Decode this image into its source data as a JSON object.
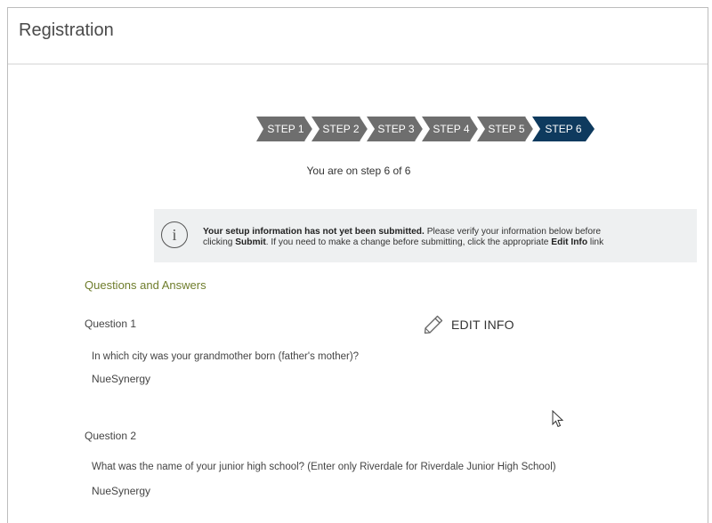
{
  "panel": {
    "title": "Registration"
  },
  "steps": {
    "items": [
      "STEP 1",
      "STEP 2",
      "STEP 3",
      "STEP 4",
      "STEP 5",
      "STEP 6"
    ],
    "active_index": 5,
    "caption": "You are on step 6 of 6",
    "colors": {
      "inactive": "#6e6e6e",
      "active": "#0e3a5e",
      "text": "#ffffff"
    }
  },
  "info": {
    "icon": "info-circle-icon",
    "line1_bold": "Your setup information has not yet been submitted.",
    "line1_rest": " Please verify your information below before",
    "line2_a": "clicking ",
    "line2_submit": "Submit",
    "line2_b": ". If you need to make a change before submitting, click the appropriate ",
    "line2_edit": "Edit Info",
    "line2_c": " link"
  },
  "qa": {
    "section_title": "Questions and Answers",
    "edit_label": "EDIT INFO",
    "edit_icon": "pencil-icon",
    "questions": [
      {
        "label": "Question 1",
        "text": "In which city was your grandmother born (father's mother)?",
        "answer": "NueSynergy"
      },
      {
        "label": "Question 2",
        "text": "What was the name of your junior high school? (Enter only Riverdale for Riverdale Junior High School)",
        "answer": "NueSynergy"
      }
    ]
  }
}
